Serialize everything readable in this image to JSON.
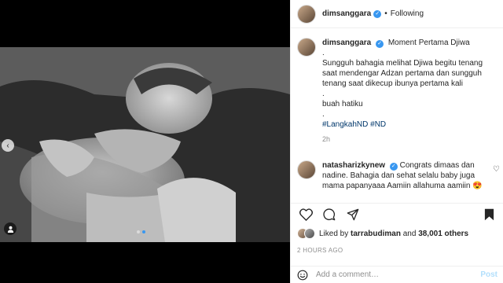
{
  "header": {
    "username": "dimsanggara",
    "separator": "•",
    "follow_state": "Following",
    "more": "•••"
  },
  "caption": {
    "username": "dimsanggara",
    "location": "Moment Pertama Djiwa",
    "dot1": ".",
    "body": "Sungguh bahagia melihat Djiwa begitu tenang saat mendengar Adzan pertama dan sungguh tenang saat dikecup ibunya pertama kali",
    "dot2": ".",
    "line2": "buah hatiku",
    "dot3": ".",
    "hashtags": "#LangkahND #ND",
    "age": "2h"
  },
  "comment": {
    "username": "natasharizkynew",
    "text": "Congrats dimaas dan nadine. Bahagia dan sehat selalu baby juga mama papanyaaa Aamiin allahuma aamiin",
    "emoji": "😍"
  },
  "likes": {
    "prefix": "Liked by",
    "user": "tarrabudiman",
    "and": "and",
    "count": "38,001 others"
  },
  "posted_ago": "2 HOURS AGO",
  "add_comment": {
    "placeholder": "Add a comment…",
    "post_label": "Post"
  },
  "icons": {
    "verified": "✓",
    "prev": "‹",
    "small_heart": "♡"
  },
  "carousel": {
    "total": 2,
    "active": 2
  },
  "colors": {
    "accent": "#3897f0",
    "link": "#00376b",
    "muted": "#8e8e8e"
  }
}
